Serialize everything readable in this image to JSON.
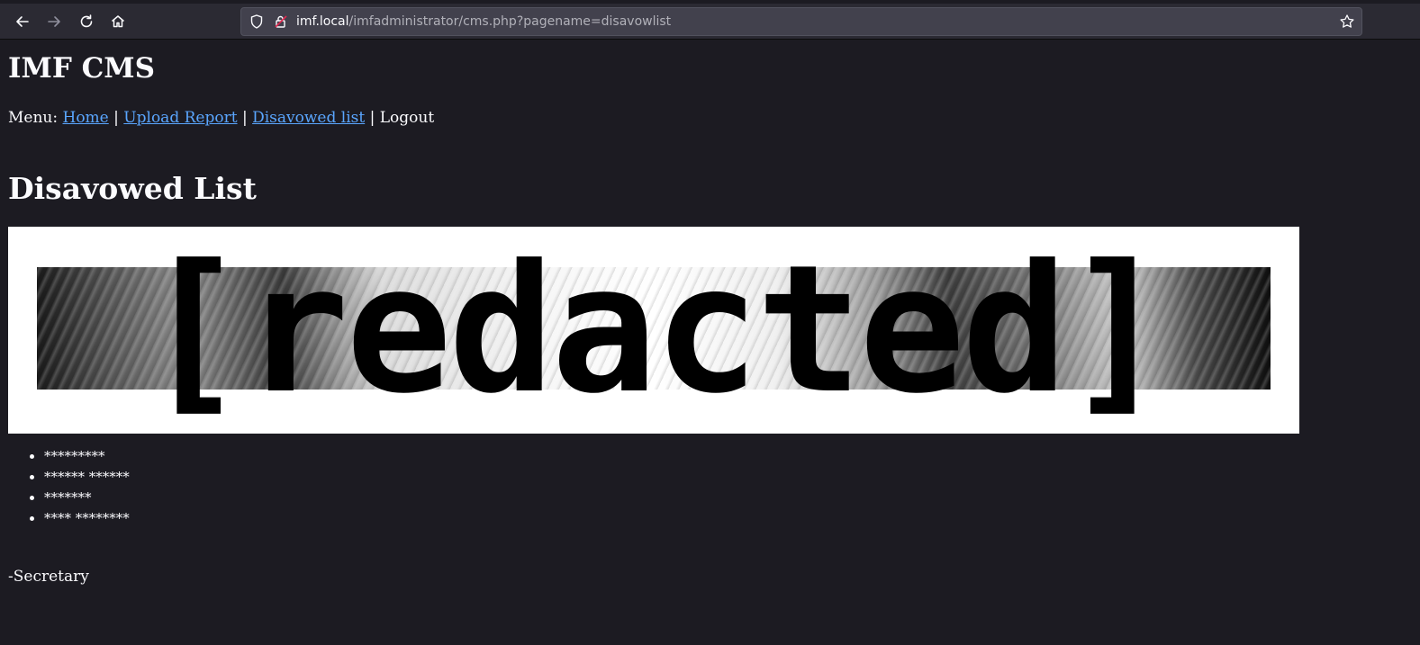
{
  "browser": {
    "url_host": "imf.local",
    "url_path": "/imfadministrator/cms.php?pagename=disavowlist",
    "icons": {
      "back": "back-arrow-icon",
      "forward": "forward-arrow-icon",
      "reload": "reload-icon",
      "home": "home-icon",
      "shield": "tracking-shield-icon",
      "lock": "insecure-lock-icon",
      "bookmark": "star-icon"
    }
  },
  "page": {
    "title": "IMF CMS",
    "menu": {
      "prefix": "Menu:",
      "separator": "|",
      "items": [
        {
          "label": "Home",
          "link": true
        },
        {
          "label": "Upload Report",
          "link": true
        },
        {
          "label": "Disavowed list",
          "link": true
        },
        {
          "label": "Logout",
          "link": false
        }
      ]
    },
    "heading": "Disavowed List",
    "banner_text": "[redacted]",
    "list": [
      "*********",
      "****** ******",
      "*******",
      "**** ********"
    ],
    "signature": "-Secretary"
  },
  "colors": {
    "background": "#1c1b22",
    "link": "#5aa6ff",
    "text": "#fbfbfe",
    "toolbar": "#2b2a33",
    "urlbar": "#42414d"
  }
}
